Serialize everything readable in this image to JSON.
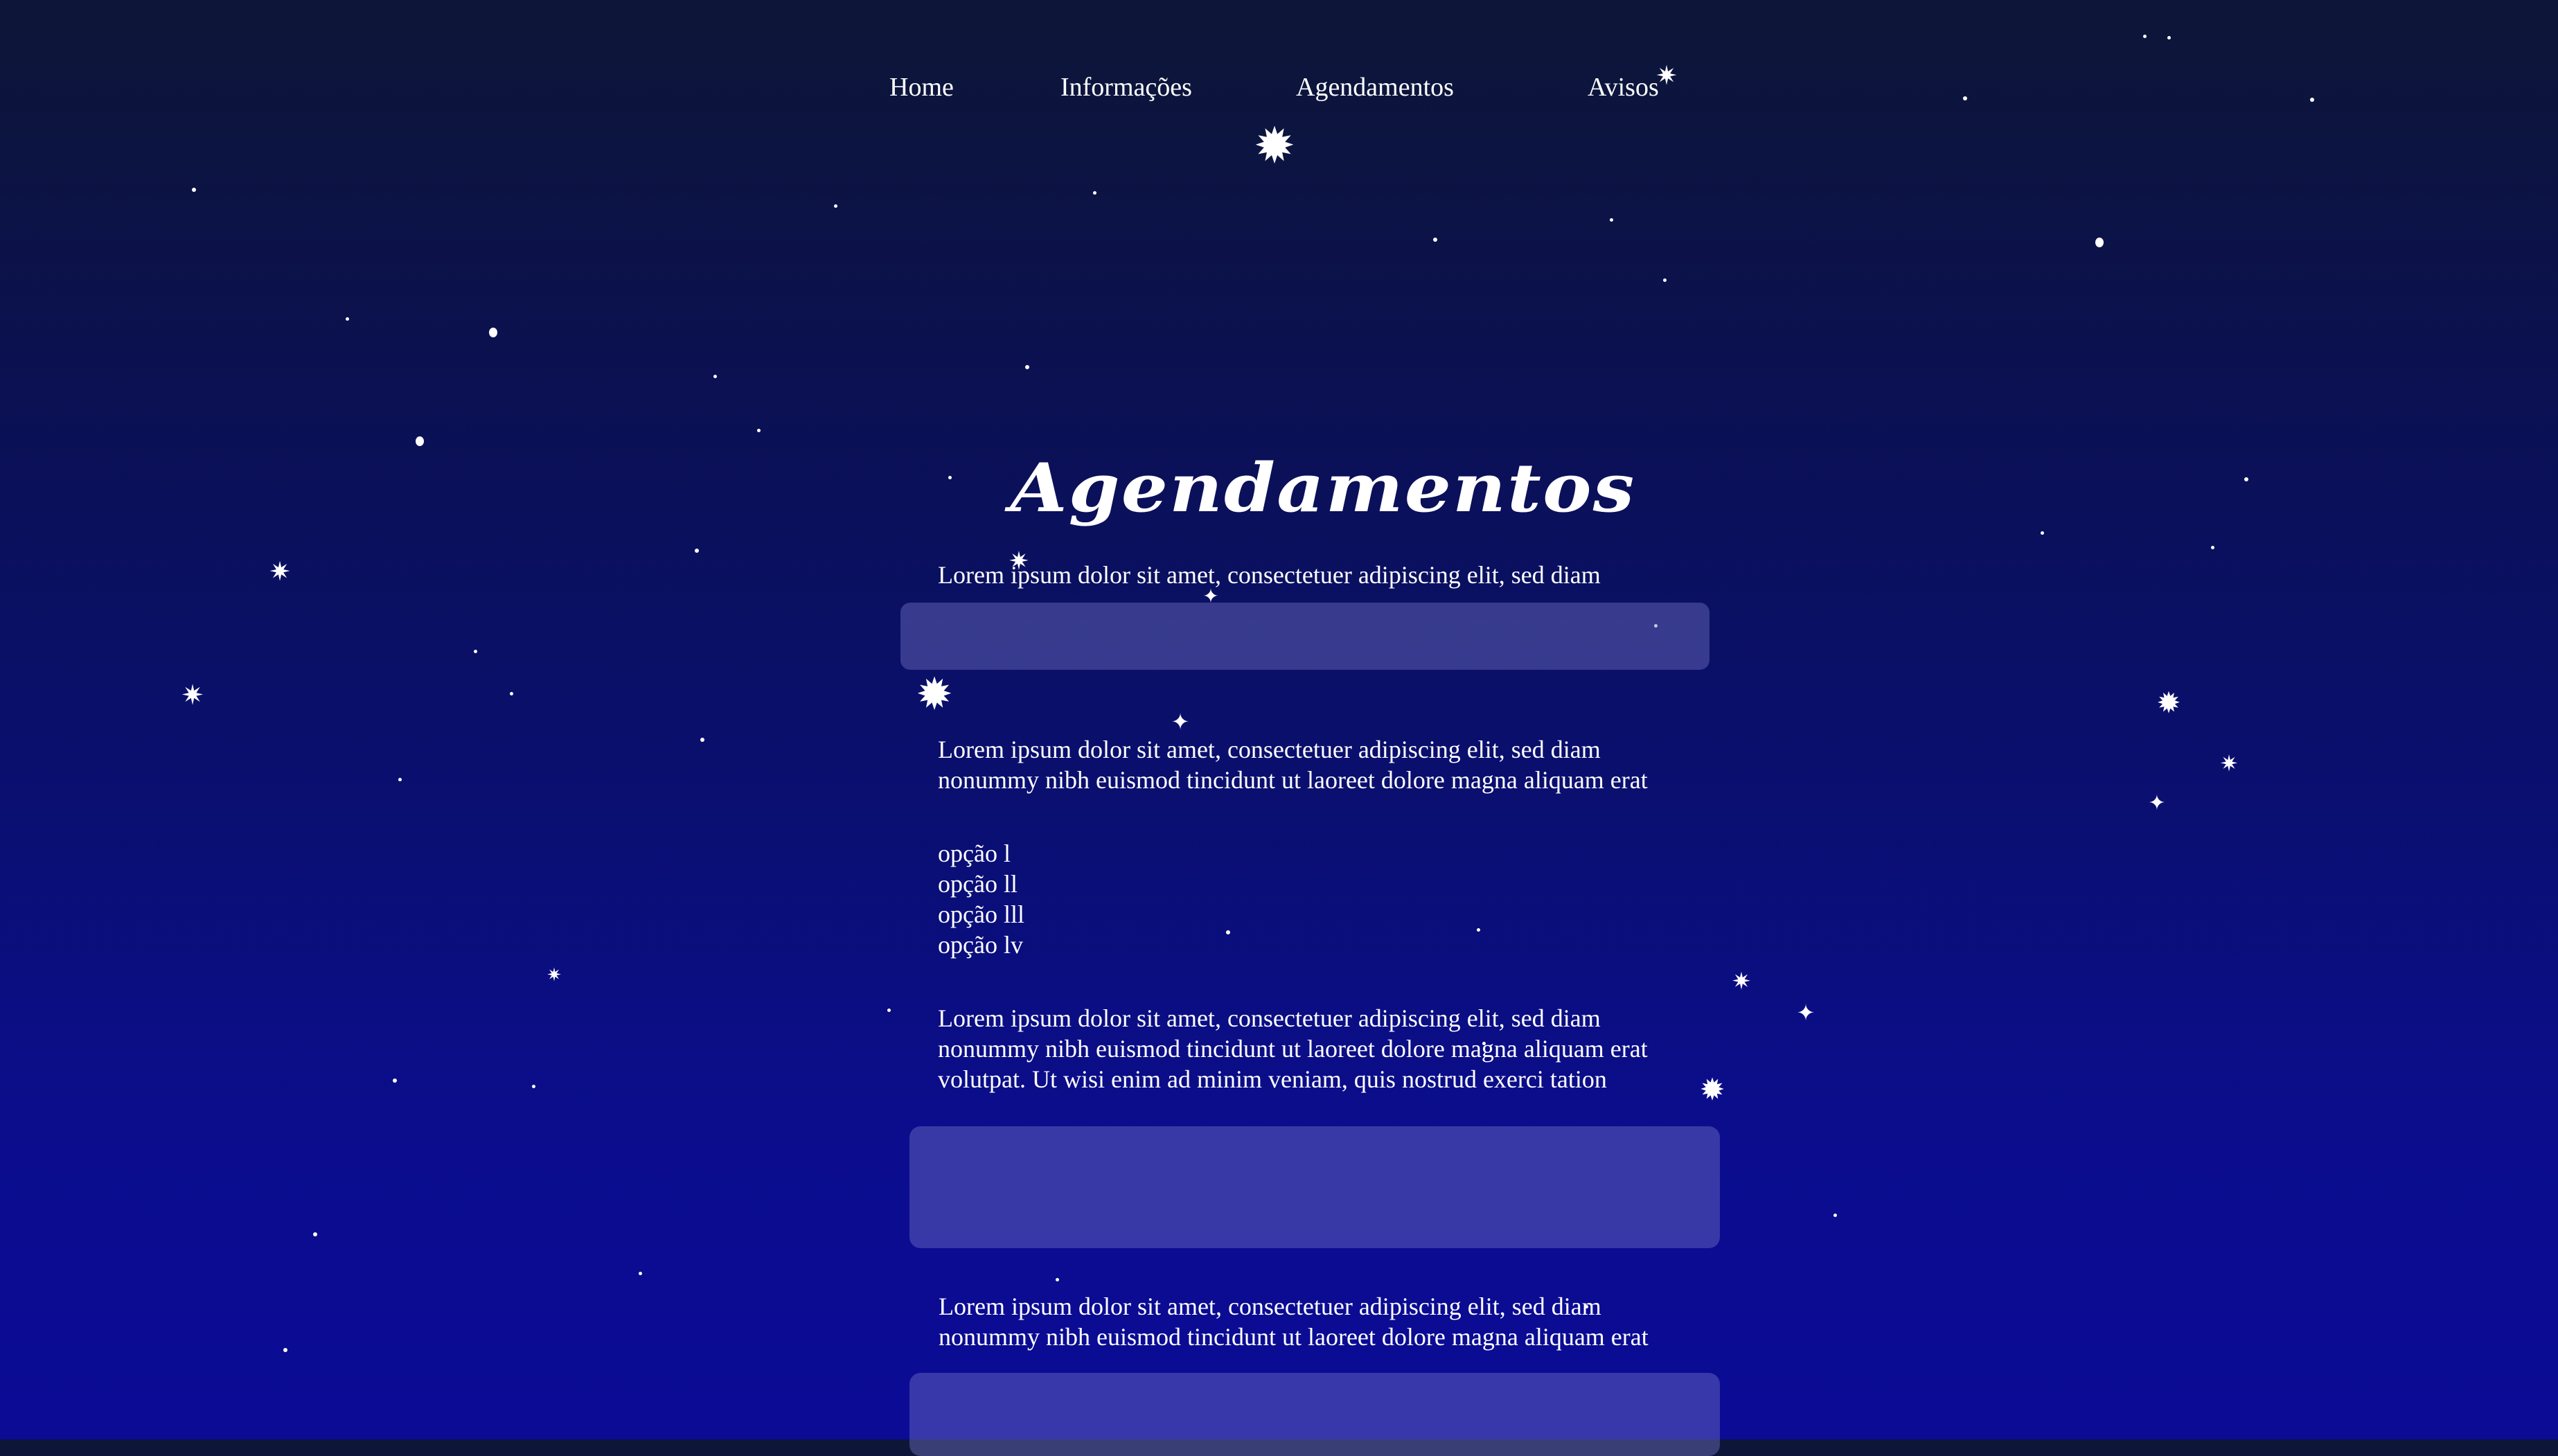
{
  "nav": {
    "items": [
      {
        "label": "Home"
      },
      {
        "label": "Informações"
      },
      {
        "label": "Agendamentos"
      },
      {
        "label": "Avisos"
      }
    ]
  },
  "main": {
    "title": "Agendamentos",
    "paragraph_1": "Lorem ipsum dolor sit amet, consectetuer adipiscing elit, sed diam",
    "paragraph_2": "Lorem ipsum dolor sit amet, consectetuer adipiscing elit, sed diam\nnonummy nibh euismod tincidunt ut laoreet dolore magna aliquam erat",
    "options": [
      "opção l",
      "opção ll",
      "opção lll",
      "opção lv"
    ],
    "paragraph_3": "Lorem ipsum dolor sit amet, consectetuer adipiscing elit, sed diam\nnonummy nibh euismod tincidunt ut laoreet dolore magna aliquam erat\nvolutpat. Ut wisi enim ad minim veniam, quis nostrud exerci tation",
    "paragraph_4": "Lorem ipsum dolor sit amet, consectetuer adipiscing elit, sed diam\nnonummy nibh euismod tincidunt ut laoreet dolore magna aliquam erat"
  },
  "colors": {
    "background_top": "#0d1637",
    "background_bottom": "#0b0b96",
    "field_fill": "rgba(120,120,200,0.42)",
    "text": "#ffffff"
  }
}
